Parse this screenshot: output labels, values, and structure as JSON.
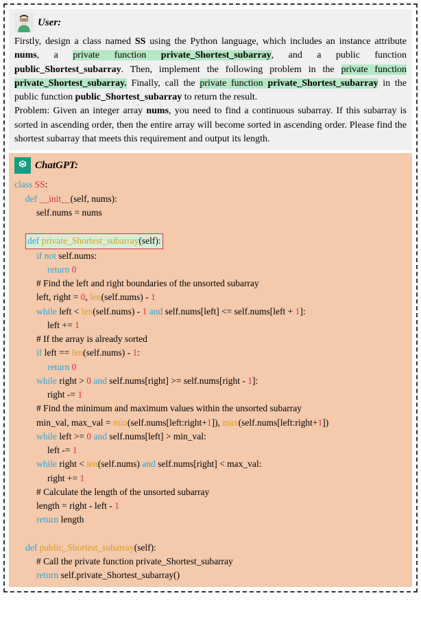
{
  "user": {
    "label": "User:",
    "prompt_parts": {
      "p1": "Firstly, design a class named ",
      "b1": "SS",
      "p2": " using the Python language, which includes an instance attribute ",
      "b2": "nums",
      "p3": ", a ",
      "h1a": "private function ",
      "h1b": "private_Shortest_subarray",
      "p4": ", and a public function ",
      "b3": "public_Shortest_subarray",
      "p5": ". Then, implement the following problem in the ",
      "h2a": "private function ",
      "h2b": "private_Shortest_subarray.",
      "p6": " Finally, call the ",
      "h3a": "private function ",
      "h3b": "private_Shortest_subarray",
      "p7": " in the public function ",
      "b4": "public_Shortest_subarray",
      "p8": " to return the result.",
      "p9": "Problem: Given an integer array ",
      "b5": "nums",
      "p10": ", you need to find a continuous subarray. If this subarray is sorted in ascending order, then the entire array will become sorted in ascending order. Please find the shortest subarray that meets this requirement and output its length."
    }
  },
  "chatgpt": {
    "label": "ChatGPT:",
    "code": {
      "l1_kw": "class",
      "l1_cls": " SS",
      "l1_rest": ":",
      "l2_kw": "def",
      "l2_fn": " __init__",
      "l2_rest": "(self, nums):",
      "l3": "self.nums = nums",
      "l5_kw": "def",
      "l5_fn": " private_Shortest_subarray",
      "l5_rest": "(self):",
      "l6_kw": "if not",
      "l6_rest": " self.nums:",
      "l7_kw": "return",
      "l7_num": " 0",
      "l8": "# Find the left and right boundaries of the unsorted subarray",
      "l9a": "left, right = ",
      "l9b": "0",
      "l9c": ", ",
      "l9d": "len",
      "l9e": "(self.nums) - ",
      "l9f": "1",
      "l10_kw": "while",
      "l10a": " left < ",
      "l10b": "len",
      "l10c": "(self.nums) - ",
      "l10d": "1",
      "l10e": " and",
      "l10f": " self.nums[left] <= self.nums[left + ",
      "l10g": "1",
      "l10h": "]:",
      "l11a": "left += ",
      "l11b": "1",
      "l12": "# If the array is already sorted",
      "l13_kw": "if",
      "l13a": " left == ",
      "l13b": "len",
      "l13c": "(self.nums) - ",
      "l13d": "1",
      "l13e": ":",
      "l14_kw": "return",
      "l14_num": " 0",
      "l15_kw": "while",
      "l15a": " right > ",
      "l15b": "0",
      "l15c": " and",
      "l15d": " self.nums[right] >= self.nums[right - ",
      "l15e": "1",
      "l15f": "]:",
      "l16a": "right -= ",
      "l16b": "1",
      "l17": "# Find the minimum and maximum values within the unsorted subarray",
      "l18a": "min_val, max_val = ",
      "l18b": "min",
      "l18c": "(self.nums[left:right+",
      "l18d": "1",
      "l18e": "]), ",
      "l18f": "max",
      "l18g": "(self.nums[left:right+",
      "l18h": "1",
      "l18i": "])",
      "l19_kw": "while",
      "l19a": " left >= ",
      "l19b": "0",
      "l19c": " and",
      "l19d": " self.nums[left] > min_val:",
      "l20a": "left -= ",
      "l20b": "1",
      "l21_kw": "while",
      "l21a": " right < ",
      "l21b": "len",
      "l21c": "(self.nums) ",
      "l21d": "and",
      "l21e": " self.nums[right] < max_val:",
      "l22a": "right += ",
      "l22b": "1",
      "l23": "# Calculate the length of the unsorted subarray",
      "l24a": "length = right - left - ",
      "l24b": "1",
      "l25_kw": "return",
      "l25a": " length",
      "l27_kw": "def",
      "l27_fn": " public_Shortest_subarray",
      "l27_rest": "(self):",
      "l28": "# Call the private function private_Shortest_subarray",
      "l29_kw": "return",
      "l29a": " self.private_Shortest_subarray()"
    }
  }
}
